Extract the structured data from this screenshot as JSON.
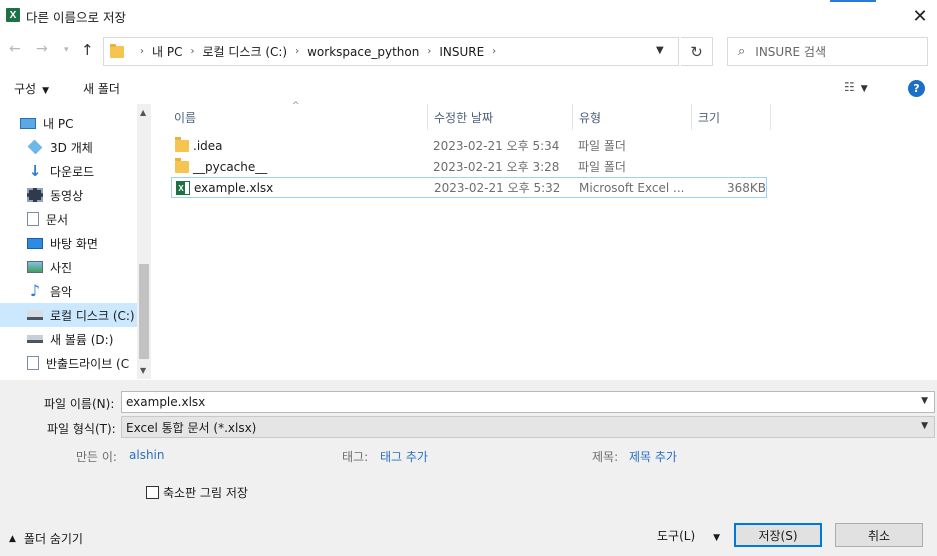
{
  "window": {
    "title": "다른 이름으로 저장",
    "app_icon_letter": "X"
  },
  "address": {
    "crumbs": [
      "내 PC",
      "로컬 디스크 (C:)",
      "workspace_python",
      "INSURE"
    ],
    "search_placeholder": "INSURE 검색"
  },
  "toolbar": {
    "organize_label": "구성",
    "new_folder_label": "새 폴더",
    "help_label": "?"
  },
  "nav": {
    "items": [
      {
        "label": "내 PC",
        "icon": "pc-icon"
      },
      {
        "label": "3D 개체",
        "icon": "3d-objects-icon"
      },
      {
        "label": "다운로드",
        "icon": "download-icon"
      },
      {
        "label": "동영상",
        "icon": "video-icon"
      },
      {
        "label": "문서",
        "icon": "document-icon"
      },
      {
        "label": "바탕 화면",
        "icon": "desktop-icon"
      },
      {
        "label": "사진",
        "icon": "pictures-icon"
      },
      {
        "label": "음악",
        "icon": "music-icon"
      },
      {
        "label": "로컬 디스크 (C:)",
        "icon": "local-disk-icon"
      },
      {
        "label": "새 볼륨 (D:)",
        "icon": "drive-icon"
      },
      {
        "label": "반출드라이브 (C",
        "icon": "drive-doc-icon"
      }
    ]
  },
  "columns": {
    "name": "이름",
    "date": "수정한 날짜",
    "type": "유형",
    "size": "크기"
  },
  "files": [
    {
      "name": ".idea",
      "date": "2023-02-21 오후 5:34",
      "type": "파일 폴더",
      "size": "",
      "icon": "folder-icon"
    },
    {
      "name": "__pycache__",
      "date": "2023-02-21 오후 3:28",
      "type": "파일 폴더",
      "size": "",
      "icon": "folder-icon"
    },
    {
      "name": "example.xlsx",
      "date": "2023-02-21 오후 5:32",
      "type": "Microsoft Excel ...",
      "size": "368KB",
      "icon": "excel-file-icon"
    }
  ],
  "form": {
    "filename_label": "파일 이름(N):",
    "filename_value": "example.xlsx",
    "filetype_label": "파일 형식(T):",
    "filetype_value": "Excel 통합 문서 (*.xlsx)",
    "author_label": "만든 이:",
    "author_value": "alshin",
    "tags_label": "태그:",
    "tags_value": "태그 추가",
    "title_label": "제목:",
    "title_value": "제목 추가",
    "thumbnail_label": "축소판 그림 저장",
    "hide_folders_label": "폴더 숨기기",
    "tools_label": "도구(L)",
    "save_label": "저장(S)",
    "cancel_label": "취소"
  },
  "colors": {
    "accent": "#0078d7",
    "selection": "#cce8ff",
    "link": "#2b6fbf",
    "excel_green": "#1e7145"
  }
}
